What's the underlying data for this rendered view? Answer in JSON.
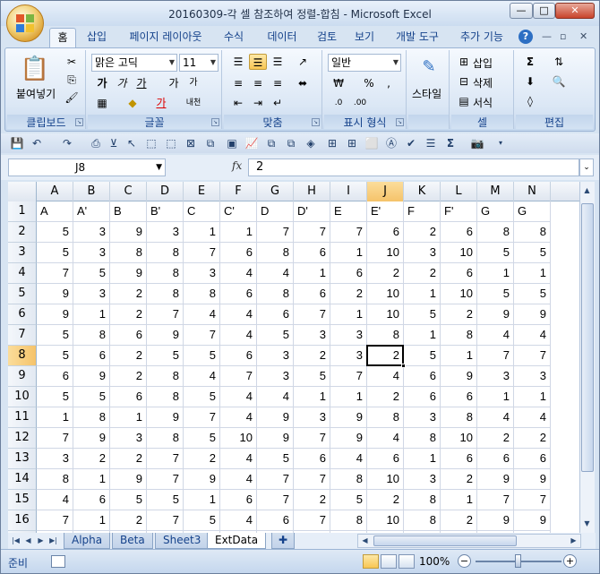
{
  "window": {
    "title": "20160309-각 셀 참조하여 정렬-합침 - Microsoft Excel",
    "min_label": "—",
    "max_label": "□",
    "close_label": "✕"
  },
  "ribbon_tabs": [
    "홈",
    "삽입",
    "페이지 레이아웃",
    "수식",
    "데이터",
    "검토",
    "보기",
    "개발 도구",
    "추가 기능"
  ],
  "ribbon": {
    "clipboard": {
      "label": "클립보드",
      "paste": "붙여넣기"
    },
    "font": {
      "label": "글꼴",
      "font_name": "맑은 고딕",
      "font_size": "11"
    },
    "alignment": {
      "label": "맞춤"
    },
    "number": {
      "label": "표시 형식",
      "format": "일반"
    },
    "styles": {
      "label": "",
      "style_button": "스타일"
    },
    "cells": {
      "label": "셀",
      "insert": "삽입",
      "delete": "삭제",
      "format": "서식"
    },
    "editing": {
      "label": "편집"
    }
  },
  "formula_bar": {
    "name_box": "J8",
    "fx": "fx",
    "content": "2"
  },
  "columns": [
    "A",
    "B",
    "C",
    "D",
    "E",
    "F",
    "G",
    "H",
    "I",
    "J",
    "K",
    "L",
    "M",
    "N"
  ],
  "selected_column": "J",
  "selected_row": 8,
  "header_row": [
    "A",
    "A'",
    "B",
    "B'",
    "C",
    "C'",
    "D",
    "D'",
    "E",
    "E'",
    "F",
    "F'",
    "G",
    "G"
  ],
  "rows": [
    [
      5,
      3,
      9,
      3,
      1,
      1,
      7,
      7,
      7,
      6,
      2,
      6,
      8,
      8
    ],
    [
      5,
      3,
      8,
      8,
      7,
      6,
      8,
      6,
      1,
      10,
      3,
      10,
      5,
      5
    ],
    [
      7,
      5,
      9,
      8,
      3,
      4,
      4,
      1,
      6,
      2,
      2,
      6,
      1,
      1
    ],
    [
      9,
      3,
      2,
      8,
      8,
      6,
      8,
      6,
      2,
      10,
      1,
      10,
      5,
      5
    ],
    [
      9,
      1,
      2,
      7,
      4,
      4,
      6,
      7,
      1,
      10,
      5,
      2,
      9,
      9
    ],
    [
      5,
      8,
      6,
      9,
      7,
      4,
      5,
      3,
      3,
      8,
      1,
      8,
      4,
      4
    ],
    [
      5,
      6,
      2,
      5,
      5,
      6,
      3,
      2,
      3,
      2,
      5,
      1,
      7,
      7
    ],
    [
      6,
      9,
      2,
      8,
      4,
      7,
      3,
      5,
      7,
      4,
      6,
      9,
      3,
      3
    ],
    [
      5,
      5,
      6,
      8,
      5,
      4,
      4,
      1,
      1,
      2,
      6,
      6,
      1,
      1
    ],
    [
      1,
      8,
      1,
      9,
      7,
      4,
      9,
      3,
      9,
      8,
      3,
      8,
      4,
      4
    ],
    [
      7,
      9,
      3,
      8,
      5,
      10,
      9,
      7,
      9,
      4,
      8,
      10,
      2,
      2
    ],
    [
      3,
      2,
      2,
      7,
      2,
      4,
      5,
      6,
      4,
      6,
      1,
      6,
      6,
      6
    ],
    [
      8,
      1,
      9,
      7,
      9,
      4,
      7,
      7,
      8,
      10,
      3,
      2,
      9,
      9
    ],
    [
      4,
      6,
      5,
      5,
      1,
      6,
      7,
      2,
      5,
      2,
      8,
      1,
      7,
      7
    ],
    [
      7,
      1,
      2,
      7,
      5,
      4,
      6,
      7,
      8,
      10,
      8,
      2,
      9,
      9
    ],
    [
      4,
      6,
      3,
      5,
      9,
      6,
      1,
      2,
      7,
      2,
      3,
      1,
      7,
      7
    ]
  ],
  "sheets": [
    "Alpha",
    "Beta",
    "Sheet3",
    "ExtData"
  ],
  "active_sheet": "ExtData",
  "status": {
    "ready": "준비",
    "zoom": "100%"
  },
  "colors": {
    "selection_header": "#f5c36a",
    "ribbon_text": "#15428b"
  }
}
